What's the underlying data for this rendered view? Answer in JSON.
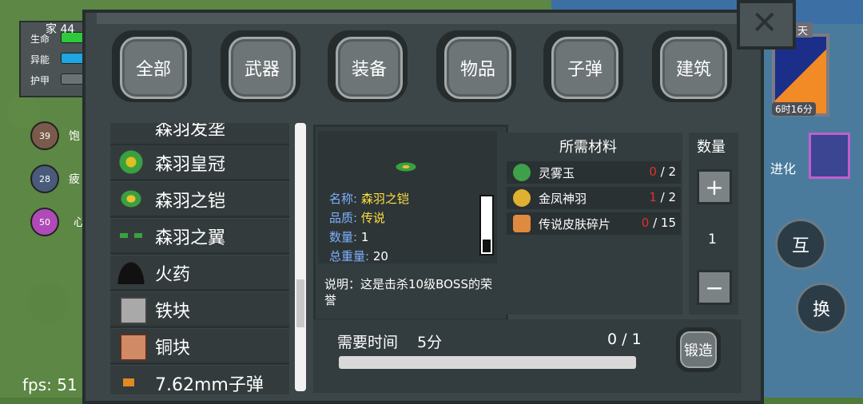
{
  "hud": {
    "home_label": "家 44",
    "stats": [
      {
        "label": "生命",
        "color": "#2ec93b"
      },
      {
        "label": "异能",
        "color": "#1ea7e0"
      },
      {
        "label": "护甲",
        "color": "#6b7377"
      }
    ],
    "buffs": [
      {
        "value": "39",
        "label": "饱",
        "color": "#7a5a4a"
      },
      {
        "value": "28",
        "label": "疲",
        "color": "#4a5a7a"
      },
      {
        "value": "50",
        "label": "心",
        "color": "#b04ab8"
      }
    ],
    "fps": "fps: 51",
    "clock_day": "天",
    "clock_time": "6时16分",
    "evolve_label": "进化",
    "interact_button": "互",
    "swap_button": "换"
  },
  "tabs": [
    "全部",
    "武器",
    "装备",
    "物品",
    "子弹",
    "建筑"
  ],
  "items": [
    {
      "name": "森羽发垄"
    },
    {
      "name": "森羽皇冠"
    },
    {
      "name": "森羽之铠"
    },
    {
      "name": "森羽之翼"
    },
    {
      "name": "火药"
    },
    {
      "name": "铁块"
    },
    {
      "name": "铜块"
    },
    {
      "name": "7.62mm子弹"
    }
  ],
  "detail": {
    "name_key": "名称: ",
    "name_val": "森羽之铠",
    "quality_key": "品质: ",
    "quality_val": "传说",
    "count_key": "数量: ",
    "count_val": "1",
    "weight_key": "总重量: ",
    "weight_val": "20",
    "description": "说明：这是击杀10级BOSS的荣誉"
  },
  "materials": {
    "title": "所需材料",
    "list": [
      {
        "name": "灵雾玉",
        "have": "0",
        "need": " / 2",
        "color": "#3fa04a"
      },
      {
        "name": "金凤神羽",
        "have": "1",
        "need": " / 2",
        "color": "#e0b030"
      },
      {
        "name": "传说皮肤碎片",
        "have": "0",
        "need": " / 15",
        "color": "#e08a40"
      }
    ]
  },
  "quantity": {
    "title": "数量",
    "value": "1",
    "plus": "+",
    "minus": "−"
  },
  "forge": {
    "time_label": "需要时间",
    "time_value": "5分",
    "progress_text": "0 / 1",
    "progress": 0,
    "button": "锻造"
  }
}
